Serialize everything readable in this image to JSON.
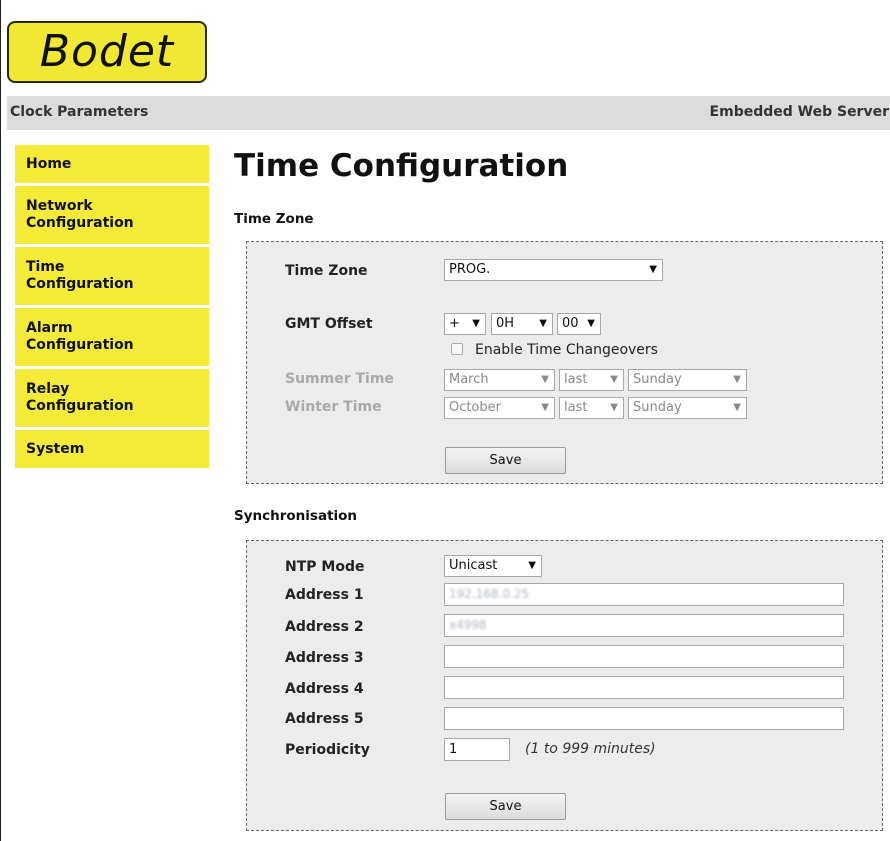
{
  "brand": {
    "logo_text": "Bodet"
  },
  "header": {
    "left": "Clock Parameters",
    "right": "Embedded Web Server"
  },
  "nav": {
    "items": [
      {
        "label": "Home"
      },
      {
        "label_line1": "Network",
        "label_line2": "Configuration"
      },
      {
        "label_line1": "Time",
        "label_line2": "Configuration"
      },
      {
        "label_line1": "Alarm",
        "label_line2": "Configuration"
      },
      {
        "label_line1": "Relay",
        "label_line2": "Configuration"
      },
      {
        "label": "System"
      }
    ]
  },
  "page": {
    "title": "Time Configuration"
  },
  "time_zone_section": {
    "title": "Time Zone",
    "time_zone": {
      "label": "Time Zone",
      "value": "PROG."
    },
    "gmt_offset": {
      "label": "GMT Offset",
      "sign": "+",
      "hours": "0H",
      "minutes": "00"
    },
    "changeover": {
      "label": "Enable Time Changeovers",
      "checked": false
    },
    "summer_time": {
      "label": "Summer Time",
      "month": "March",
      "week": "last",
      "day": "Sunday"
    },
    "winter_time": {
      "label": "Winter Time",
      "month": "October",
      "week": "last",
      "day": "Sunday"
    },
    "save_label": "Save"
  },
  "sync_section": {
    "title": "Synchronisation",
    "ntp_mode": {
      "label": "NTP Mode",
      "value": "Unicast"
    },
    "addresses": [
      {
        "label": "Address 1",
        "value": "192.168.0.25"
      },
      {
        "label": "Address 2",
        "value": "x4998"
      },
      {
        "label": "Address 3",
        "value": ""
      },
      {
        "label": "Address 4",
        "value": ""
      },
      {
        "label": "Address 5",
        "value": ""
      }
    ],
    "periodicity": {
      "label": "Periodicity",
      "value": "1",
      "hint": "(1 to 999 minutes)"
    },
    "save_label": "Save"
  },
  "icons": {
    "dropdown": "▼"
  }
}
